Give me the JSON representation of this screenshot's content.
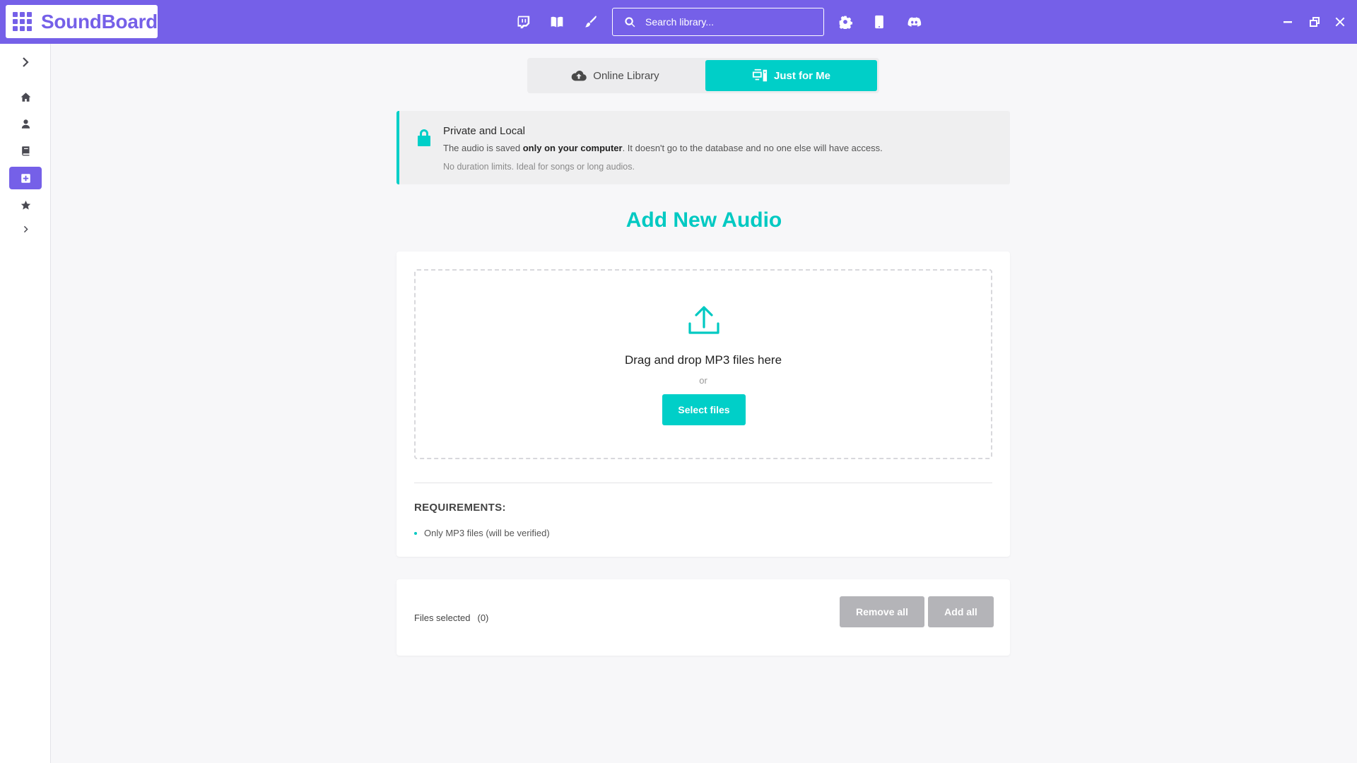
{
  "app": {
    "name": "SoundBoard"
  },
  "colors": {
    "brand": "#7560e8",
    "accent": "#00cfc8",
    "disabled": "#b4b4b8"
  },
  "toolbar": {
    "icons": [
      "twitch-icon",
      "book-icon",
      "brush-icon",
      "gear-icon",
      "mobile-icon",
      "discord-icon"
    ],
    "search_placeholder": "Search library..."
  },
  "window_controls": [
    "minimize-icon",
    "restore-icon",
    "close-icon"
  ],
  "sidebar": {
    "items": [
      {
        "name": "expand",
        "icon": "chevron-right-icon"
      },
      {
        "name": "home",
        "icon": "home-icon"
      },
      {
        "name": "profile",
        "icon": "user-icon"
      },
      {
        "name": "library",
        "icon": "book-icon"
      },
      {
        "name": "add-audio",
        "icon": "plus-square-icon",
        "active": true
      },
      {
        "name": "favorites",
        "icon": "star-icon"
      },
      {
        "name": "more",
        "icon": "chevron-right-icon"
      }
    ]
  },
  "tabs": [
    {
      "label": "Online Library",
      "icon": "cloud-upload-icon",
      "active": false
    },
    {
      "label": "Just for Me",
      "icon": "computer-icon",
      "active": true
    }
  ],
  "notice": {
    "title": "Private and Local",
    "line_prefix": "The audio is saved ",
    "line_bold": "only on your computer",
    "line_suffix": ". It doesn't go to the database and no one else will have access.",
    "sub": "No duration limits. Ideal for songs or long audios."
  },
  "main": {
    "heading": "Add New Audio",
    "dropzone": {
      "text": "Drag and drop MP3 files here",
      "or": "or",
      "button": "Select files"
    },
    "requirements": {
      "title": "REQUIREMENTS:",
      "items": [
        "Only MP3 files (will be verified)"
      ]
    }
  },
  "files": {
    "label": "Files selected",
    "count": "(0)",
    "remove_all": "Remove all",
    "add_all": "Add all"
  }
}
